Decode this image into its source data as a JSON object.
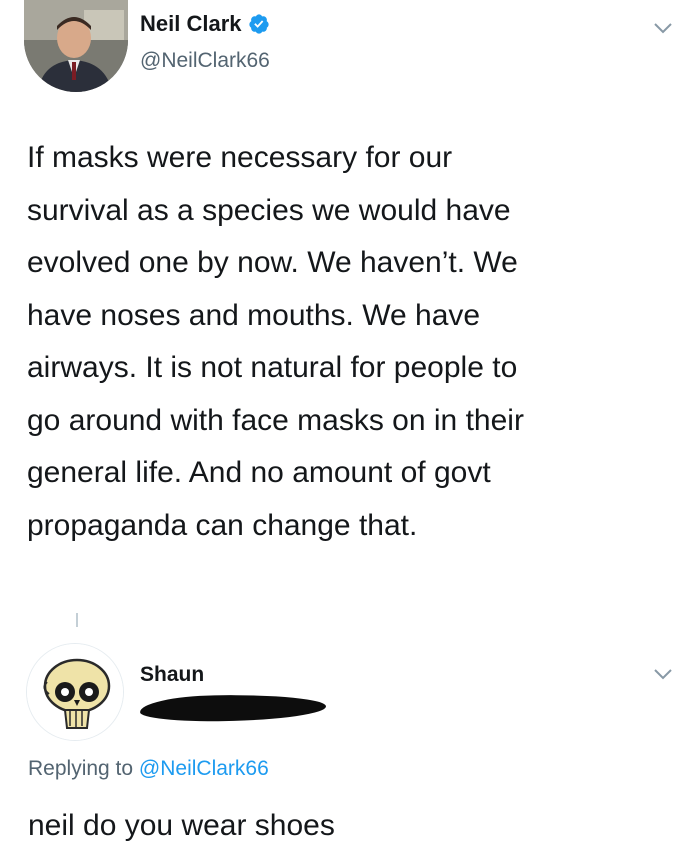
{
  "tweet": {
    "author": {
      "name": "Neil Clark",
      "handle": "@NeilClark66",
      "verified_icon": "verified-badge-icon"
    },
    "text": "If masks were necessary for our\nsurvival as a species we would have\nevolved one by now. We haven’t. We\nhave noses and mouths. We have\nairways. It is not natural for people to\ngo around with face masks on in their\ngeneral life. And no amount of govt\npropaganda can change that.",
    "menu_icon": "chevron-down-icon"
  },
  "reply": {
    "author": {
      "name": "Shaun"
    },
    "replying_prefix": "Replying to ",
    "replying_handle": "@NeilClark66",
    "text": "neil do you wear shoes",
    "menu_icon": "chevron-down-icon"
  },
  "colors": {
    "text": "#14171a",
    "secondary": "#536471",
    "link": "#1d9bf0",
    "verified": "#1d9bf0"
  }
}
